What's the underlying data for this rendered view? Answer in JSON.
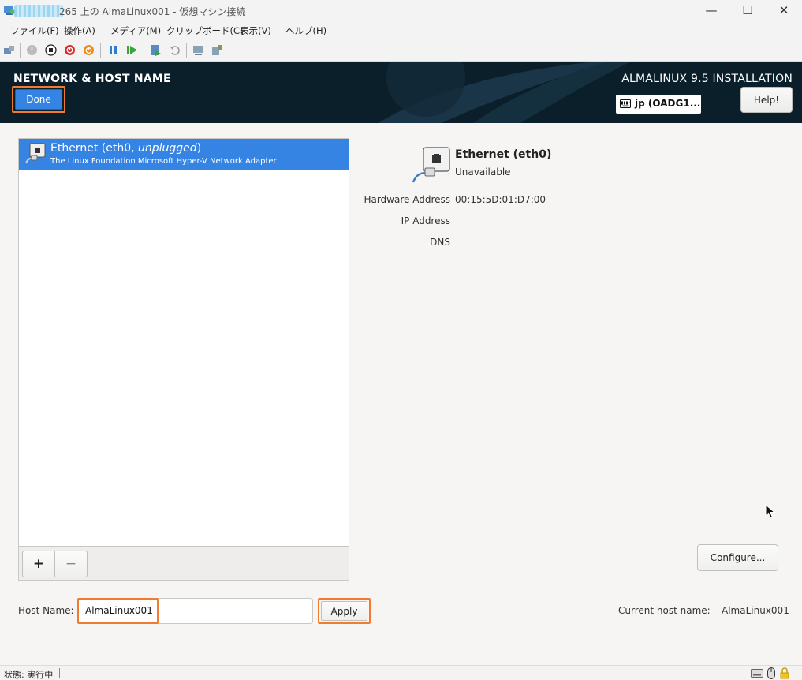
{
  "window": {
    "title": "265 上の AlmaLinux001 - 仮想マシン接続",
    "minimize": "—",
    "maximize": "☐",
    "close": "✕"
  },
  "menu": [
    "ファイル(F)",
    "操作(A)",
    "メディア(M)",
    "クリップボード(C)",
    "表示(V)",
    "ヘルプ(H)"
  ],
  "toolbar_icons": [
    "ctrl-alt-del-icon",
    "start-icon",
    "stop-icon",
    "shutdown-icon",
    "power-icon",
    "pause-icon",
    "resume-icon",
    "checkpoint-icon",
    "revert-icon",
    "enhanced-session-icon",
    "share-icon"
  ],
  "header": {
    "page_title": "NETWORK & HOST NAME",
    "done_label": "Done",
    "install_title": "ALMALINUX 9.5 INSTALLATION",
    "keyboard_layout": "jp (OADG1...",
    "help_label": "Help!"
  },
  "devices": [
    {
      "name": "Ethernet (eth0, ",
      "state": "unplugged",
      "name_close": ")",
      "description": "The Linux Foundation Microsoft Hyper-V Network Adapter"
    }
  ],
  "list_buttons": {
    "add": "+",
    "remove": "−"
  },
  "details": {
    "name": "Ethernet (eth0)",
    "status": "Unavailable",
    "rows": [
      {
        "label": "Hardware Address",
        "value": "00:15:5D:01:D7:00"
      },
      {
        "label": "IP Address",
        "value": ""
      },
      {
        "label": "DNS",
        "value": ""
      }
    ],
    "configure_label": "Configure..."
  },
  "hostname": {
    "label": "Host Name:",
    "value": "AlmaLinux001",
    "apply_label": "Apply",
    "current_label": "Current host name:",
    "current_value": "AlmaLinux001"
  },
  "statusbar": {
    "text": "状態: 実行中"
  },
  "colors": {
    "header_bg": "#0b1f2b",
    "selection": "#3584e4",
    "highlight": "#f07b31"
  }
}
